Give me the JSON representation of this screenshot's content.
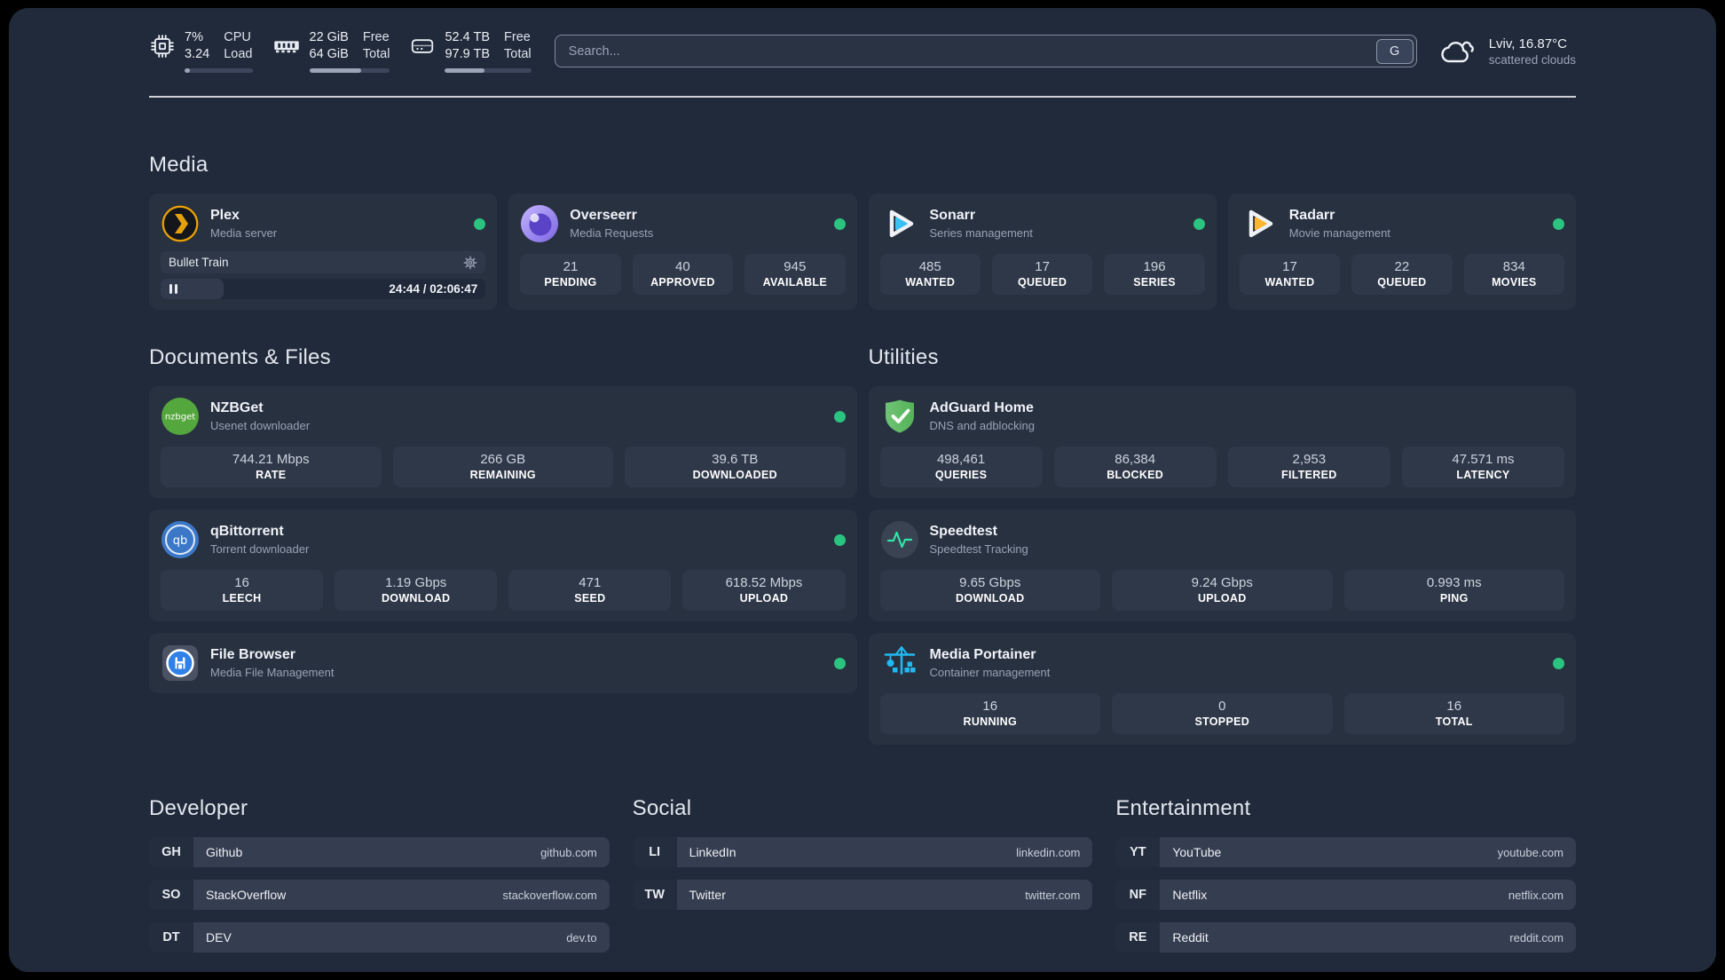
{
  "colors": {
    "background": "#212a3a",
    "card": "#283140",
    "tile": "#2e3848",
    "status_online": "#2bc380",
    "accent_plex": "#e5a00d",
    "accent_sonarr": "#38c1f1",
    "accent_radarr": "#ffb52e"
  },
  "header": {
    "system": [
      {
        "icon": "cpu-icon",
        "values": [
          "7%",
          "3.24"
        ],
        "labels": [
          "CPU",
          "Load"
        ],
        "progress_pct": 8
      },
      {
        "icon": "ram-icon",
        "values": [
          "22 GiB",
          "64 GiB"
        ],
        "labels": [
          "Free",
          "Total"
        ],
        "progress_pct": 64
      },
      {
        "icon": "disk-icon",
        "values": [
          "52.4 TB",
          "97.9 TB"
        ],
        "labels": [
          "Free",
          "Total"
        ],
        "progress_pct": 46
      }
    ],
    "search": {
      "placeholder": "Search...",
      "button": "G"
    },
    "weather": {
      "icon": "cloud-icon",
      "location": "Lviv, 16.87°C",
      "condition": "scattered clouds"
    }
  },
  "sections": {
    "media": {
      "title": "Media",
      "apps": [
        {
          "icon": "plex-icon",
          "name": "Plex",
          "subtitle": "Media server",
          "online": true,
          "player": {
            "title": "Bullet Train",
            "time": "24:44 / 02:06:47",
            "progress_pct": 19.5
          }
        },
        {
          "icon": "overseerr-icon",
          "name": "Overseerr",
          "subtitle": "Media Requests",
          "online": true,
          "stats": [
            {
              "value": "21",
              "label": "PENDING"
            },
            {
              "value": "40",
              "label": "APPROVED"
            },
            {
              "value": "945",
              "label": "AVAILABLE"
            }
          ]
        },
        {
          "icon": "sonarr-icon",
          "name": "Sonarr",
          "subtitle": "Series management",
          "online": true,
          "stats": [
            {
              "value": "485",
              "label": "WANTED"
            },
            {
              "value": "17",
              "label": "QUEUED"
            },
            {
              "value": "196",
              "label": "SERIES"
            }
          ]
        },
        {
          "icon": "radarr-icon",
          "name": "Radarr",
          "subtitle": "Movie management",
          "online": true,
          "stats": [
            {
              "value": "17",
              "label": "WANTED"
            },
            {
              "value": "22",
              "label": "QUEUED"
            },
            {
              "value": "834",
              "label": "MOVIES"
            }
          ]
        }
      ]
    },
    "documents": {
      "title": "Documents & Files",
      "apps": [
        {
          "icon": "nzbget-icon",
          "name": "NZBGet",
          "subtitle": "Usenet downloader",
          "online": true,
          "stats": [
            {
              "value": "744.21 Mbps",
              "label": "RATE"
            },
            {
              "value": "266 GB",
              "label": "REMAINING"
            },
            {
              "value": "39.6 TB",
              "label": "DOWNLOADED"
            }
          ]
        },
        {
          "icon": "qbittorrent-icon",
          "name": "qBittorrent",
          "subtitle": "Torrent downloader",
          "online": true,
          "stats": [
            {
              "value": "16",
              "label": "LEECH"
            },
            {
              "value": "1.19 Gbps",
              "label": "DOWNLOAD"
            },
            {
              "value": "471",
              "label": "SEED"
            },
            {
              "value": "618.52 Mbps",
              "label": "UPLOAD"
            }
          ]
        },
        {
          "icon": "filebrowser-icon",
          "name": "File Browser",
          "subtitle": "Media File Management",
          "online": true
        }
      ]
    },
    "utilities": {
      "title": "Utilities",
      "apps": [
        {
          "icon": "adguard-icon",
          "name": "AdGuard Home",
          "subtitle": "DNS and adblocking",
          "stats": [
            {
              "value": "498,461",
              "label": "QUERIES"
            },
            {
              "value": "86,384",
              "label": "BLOCKED"
            },
            {
              "value": "2,953",
              "label": "FILTERED"
            },
            {
              "value": "47.571 ms",
              "label": "LATENCY"
            }
          ]
        },
        {
          "icon": "speedtest-icon",
          "name": "Speedtest",
          "subtitle": "Speedtest Tracking",
          "stats": [
            {
              "value": "9.65 Gbps",
              "label": "DOWNLOAD"
            },
            {
              "value": "9.24 Gbps",
              "label": "UPLOAD"
            },
            {
              "value": "0.993 ms",
              "label": "PING"
            }
          ]
        },
        {
          "icon": "portainer-icon",
          "name": "Media Portainer",
          "subtitle": "Container management",
          "online": true,
          "stats": [
            {
              "value": "16",
              "label": "RUNNING"
            },
            {
              "value": "0",
              "label": "STOPPED"
            },
            {
              "value": "16",
              "label": "TOTAL"
            }
          ]
        }
      ]
    },
    "bookmarks": [
      {
        "title": "Developer",
        "links": [
          {
            "abbr": "GH",
            "name": "Github",
            "url": "github.com"
          },
          {
            "abbr": "SO",
            "name": "StackOverflow",
            "url": "stackoverflow.com"
          },
          {
            "abbr": "DT",
            "name": "DEV",
            "url": "dev.to"
          }
        ]
      },
      {
        "title": "Social",
        "links": [
          {
            "abbr": "LI",
            "name": "LinkedIn",
            "url": "linkedin.com"
          },
          {
            "abbr": "TW",
            "name": "Twitter",
            "url": "twitter.com"
          }
        ]
      },
      {
        "title": "Entertainment",
        "links": [
          {
            "abbr": "YT",
            "name": "YouTube",
            "url": "youtube.com"
          },
          {
            "abbr": "NF",
            "name": "Netflix",
            "url": "netflix.com"
          },
          {
            "abbr": "RE",
            "name": "Reddit",
            "url": "reddit.com"
          }
        ]
      }
    ]
  }
}
